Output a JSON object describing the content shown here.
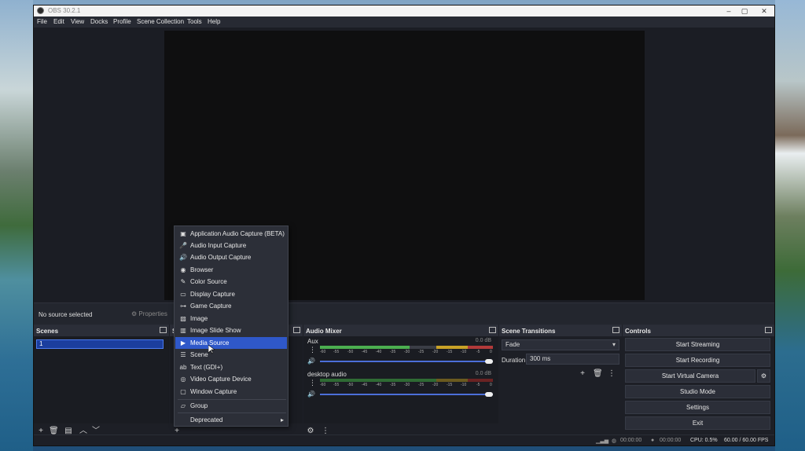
{
  "window": {
    "title": "OBS 30.2.1"
  },
  "menu": [
    "File",
    "Edit",
    "View",
    "Docks",
    "Profile",
    "Scene Collection",
    "Tools",
    "Help"
  ],
  "source_bar": {
    "no_selection": "No source selected",
    "properties": "Properties"
  },
  "scenes": {
    "title": "Scenes",
    "items": [
      "1"
    ]
  },
  "sources": {
    "title": "S"
  },
  "audio_mixer": {
    "title": "Audio Mixer",
    "channels": [
      {
        "name": "Aux",
        "db": "0.0 dB"
      },
      {
        "name": "desktop audio",
        "db": "0.0 dB"
      }
    ],
    "ticks": [
      "-60",
      "-55",
      "-50",
      "-45",
      "-40",
      "-35",
      "-30",
      "-25",
      "-20",
      "-15",
      "-10",
      "-5",
      "0"
    ]
  },
  "transitions": {
    "title": "Scene Transitions",
    "selected": "Fade",
    "duration_label": "Duration",
    "duration_value": "300 ms"
  },
  "controls": {
    "title": "Controls",
    "buttons": [
      "Start Streaming",
      "Start Recording",
      "Start Virtual Camera",
      "Studio Mode",
      "Settings",
      "Exit"
    ]
  },
  "status": {
    "stream_time": "00:00:00",
    "rec_time": "00:00:00",
    "cpu": "CPU: 0.5%",
    "fps": "60.00 / 60.00 FPS"
  },
  "context_menu": {
    "items": [
      {
        "label": "Application Audio Capture (BETA)",
        "icon": "app-audio-icon"
      },
      {
        "label": "Audio Input Capture",
        "icon": "microphone-icon"
      },
      {
        "label": "Audio Output Capture",
        "icon": "speaker-icon"
      },
      {
        "label": "Browser",
        "icon": "globe-icon"
      },
      {
        "label": "Color Source",
        "icon": "brush-icon"
      },
      {
        "label": "Display Capture",
        "icon": "monitor-icon"
      },
      {
        "label": "Game Capture",
        "icon": "gamepad-icon"
      },
      {
        "label": "Image",
        "icon": "image-icon"
      },
      {
        "label": "Image Slide Show",
        "icon": "slideshow-icon"
      },
      {
        "label": "Media Source",
        "icon": "play-icon"
      },
      {
        "label": "Scene",
        "icon": "list-icon"
      },
      {
        "label": "Text (GDI+)",
        "icon": "text-icon"
      },
      {
        "label": "Video Capture Device",
        "icon": "camera-icon"
      },
      {
        "label": "Window Capture",
        "icon": "window-icon"
      }
    ],
    "group": "Group",
    "deprecated": "Deprecated",
    "selected_index": 9
  }
}
